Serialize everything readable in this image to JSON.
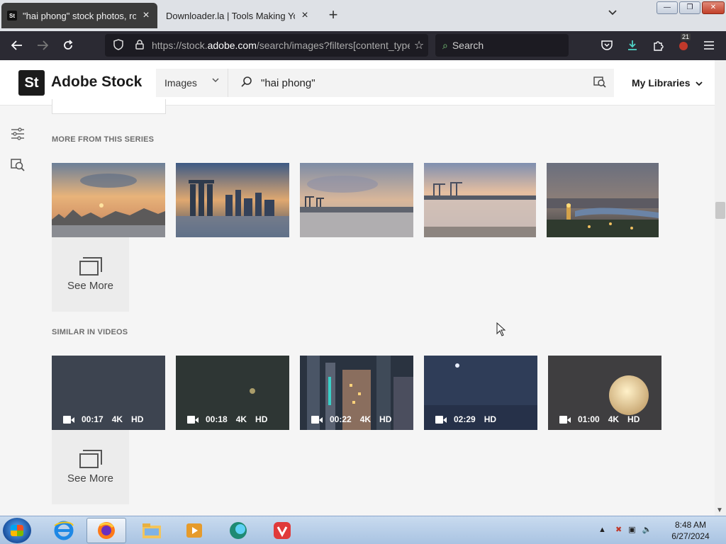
{
  "browser": {
    "tabs": [
      {
        "title": "\"hai phong\" stock photos, royalty-free",
        "favicon": "St",
        "active": true
      },
      {
        "title": "Downloader.la | Tools Making Your Life Easier",
        "active": false
      }
    ],
    "window_controls": {
      "minimize": "—",
      "maximize": "❐",
      "close": "✕"
    },
    "url": {
      "prefix": "https://stock.",
      "domain": "adobe.com",
      "rest": "/search/images?filters[content_type:photo]"
    },
    "search_placeholder": "Search",
    "extension_badge": "21",
    "colors": {
      "toolbar": "#2b2a33",
      "tabstrip": "#dee1e6"
    }
  },
  "header": {
    "logo_mark": "St",
    "logo_text": "Adobe Stock",
    "content_type": "Images",
    "query": "\"hai phong\"",
    "my_libraries": "My Libraries"
  },
  "sections": [
    {
      "title": "MORE FROM THIS SERIES",
      "see_more": "See More",
      "items": [
        {
          "kind": "photo",
          "scene": "sunset-city"
        },
        {
          "kind": "photo",
          "scene": "marina-skyline"
        },
        {
          "kind": "photo",
          "scene": "harbor-cranes-dusk"
        },
        {
          "kind": "photo",
          "scene": "port-reflection"
        },
        {
          "kind": "photo",
          "scene": "city-river-night"
        }
      ]
    },
    {
      "title": "SIMILAR IN VIDEOS",
      "see_more": "See More",
      "items": [
        {
          "kind": "video",
          "duration": "00:17",
          "tags": [
            "4K",
            "HD"
          ]
        },
        {
          "kind": "video",
          "duration": "00:18",
          "tags": [
            "4K",
            "HD"
          ]
        },
        {
          "kind": "video",
          "duration": "00:22",
          "tags": [
            "4K",
            "HD"
          ]
        },
        {
          "kind": "video",
          "duration": "02:29",
          "tags": [
            "HD"
          ]
        },
        {
          "kind": "video",
          "duration": "01:00",
          "tags": [
            "4K",
            "HD"
          ]
        }
      ]
    }
  ],
  "taskbar": {
    "time": "8:48 AM",
    "date": "6/27/2024"
  }
}
